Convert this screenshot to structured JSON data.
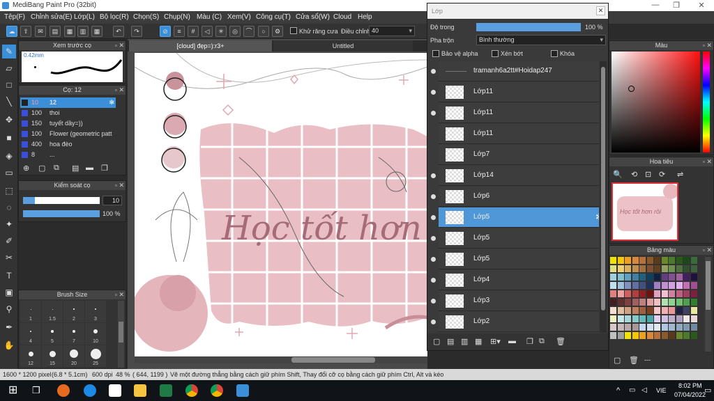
{
  "window": {
    "title": "MediBang Paint Pro (32bit)"
  },
  "menu": [
    "Tệp(F)",
    "Chỉnh sửa(E)",
    "Lớp(L)",
    "Bộ lọc(R)",
    "Chọn(S)",
    "Chụp(N)",
    "Màu (C)",
    "Xem(V)",
    "Công cụ(T)",
    "Cửa sổ(W)",
    "Cloud",
    "Help"
  ],
  "toolbar": {
    "antialias_label": "Khử răng cưa",
    "adjust_label": "Điều chỉnh",
    "adjust_value": "40"
  },
  "brush_preview": {
    "title": "Xem trước cọ",
    "size": "0.42mm"
  },
  "brush_panel": {
    "title": "Cọ: 12",
    "items": [
      {
        "size": "10",
        "name": "12"
      },
      {
        "size": "100",
        "name": "thoi"
      },
      {
        "size": "150",
        "name": "tuyết dầy=))"
      },
      {
        "size": "100",
        "name": "Flower (geometric patt"
      },
      {
        "size": "400",
        "name": "hoa đèo"
      },
      {
        "size": "8",
        "name": "..."
      }
    ]
  },
  "brush_control": {
    "title": "Kiểm soát cọ",
    "size_value": "10",
    "opacity_value": "100 %",
    "size_fill": 0.15,
    "opacity_fill": 1.0
  },
  "brush_size": {
    "title": "Brush Size",
    "labels": [
      "1",
      "1.5",
      "2",
      "3",
      "4",
      "5",
      "7",
      "10",
      "12",
      "15",
      "20",
      "25"
    ]
  },
  "tabs": [
    {
      "label": "[cloud] đẹp=):r3+"
    },
    {
      "label": "Untitled"
    }
  ],
  "canvas": {
    "artwork_text": "Học tốt hơn rồi"
  },
  "layer_window": {
    "title": "Lớp",
    "opacity_label": "Độ trong",
    "opacity_value": "100 %",
    "blend_label": "Pha trộn",
    "blend_value": "Bình thường",
    "protect_alpha": "Bảo vệ alpha",
    "clipping": "Xén bớt",
    "lock": "Khóa",
    "layers": [
      {
        "name": "tramanh6a2tt#Hoidap247",
        "visible": true,
        "selected": false
      },
      {
        "name": "Lớp11",
        "visible": true,
        "selected": false
      },
      {
        "name": "Lớp11",
        "visible": true,
        "selected": false
      },
      {
        "name": "Lớp11",
        "visible": false,
        "selected": false
      },
      {
        "name": "Lớp7",
        "visible": false,
        "selected": false
      },
      {
        "name": "Lớp14",
        "visible": true,
        "selected": false
      },
      {
        "name": "Lớp6",
        "visible": true,
        "selected": false
      },
      {
        "name": "Lớp5",
        "visible": true,
        "selected": true
      },
      {
        "name": "Lớp5",
        "visible": true,
        "selected": false
      },
      {
        "name": "Lớp5",
        "visible": true,
        "selected": false
      },
      {
        "name": "Lớp4",
        "visible": true,
        "selected": false
      },
      {
        "name": "Lớp3",
        "visible": true,
        "selected": false
      },
      {
        "name": "Lớp2",
        "visible": true,
        "selected": false
      }
    ]
  },
  "color_panel": {
    "title": "Màu"
  },
  "navigator": {
    "title": "Hoa tiêu",
    "thumb_text": "Học tốt hơn rồi"
  },
  "palette": {
    "title": "Bảng màu",
    "footer_text": "---"
  },
  "status": {
    "canvas_size": "1600 * 1200 pixel",
    "physical_size": "(6.8 * 5.1cm)",
    "dpi": "600 dpi",
    "zoom": "48 %",
    "cursor": "( 644, 1199 )",
    "hint": "Vẽ một đường thẳng bằng cách giữ phím Shift, Thay đổi cỡ cọ bằng cách giữ phím Ctrl, Alt và kéo"
  },
  "taskbar": {
    "lang": "VIE",
    "time": "8:02 PM",
    "date": "07/04/2022"
  },
  "colors": {
    "accent": "#3b8fd9",
    "canvas_pink": "#e7bcc3",
    "text_pink": "#a56b77"
  }
}
